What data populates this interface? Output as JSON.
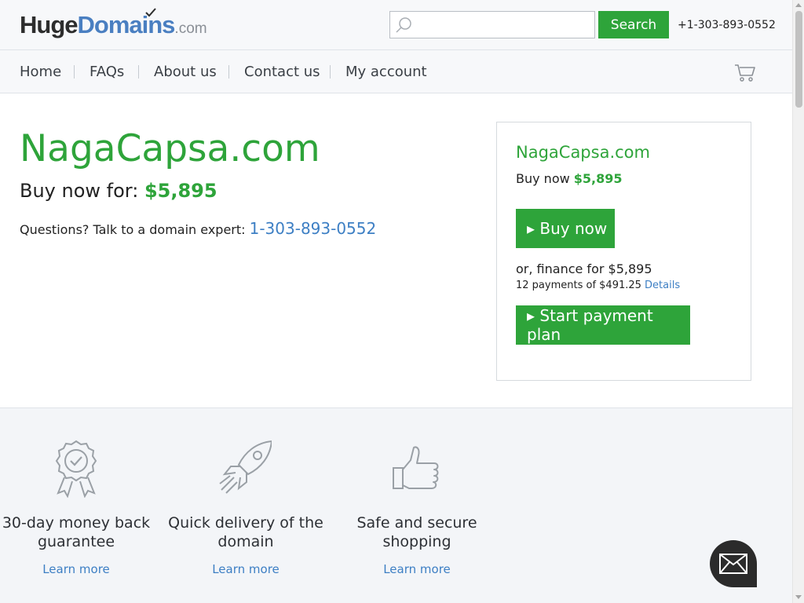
{
  "header": {
    "logo": {
      "huge": "Huge",
      "domains": "Domains",
      "com": ".com"
    },
    "search": {
      "placeholder": "",
      "button_label": "Search"
    },
    "phone": "+1-303-893-0552"
  },
  "nav": {
    "items": [
      {
        "label": "Home"
      },
      {
        "label": "FAQs"
      },
      {
        "label": "About us"
      },
      {
        "label": "Contact us"
      },
      {
        "label": "My account"
      }
    ],
    "cart_icon": "shopping-cart-icon"
  },
  "main": {
    "domain": "NagaCapsa.com",
    "buy_prefix": "Buy now for: ",
    "price": "$5,895",
    "questions_text": "Questions? Talk to a domain expert: ",
    "expert_phone": "1-303-893-0552"
  },
  "panel": {
    "domain": "NagaCapsa.com",
    "buy_now_prefix": "Buy now ",
    "price": "$5,895",
    "buy_button": "▸ Buy now",
    "finance_text": "or, finance for $5,895",
    "payments_text": "12 payments of $491.25 ",
    "details_link": "Details",
    "plan_button": "▸ Start payment plan"
  },
  "features": [
    {
      "icon": "ribbon-check-icon",
      "title": "30-day money back guarantee",
      "link": "Learn more"
    },
    {
      "icon": "rocket-icon",
      "title": "Quick delivery of the domain",
      "link": "Learn more"
    },
    {
      "icon": "thumbs-up-icon",
      "title": "Safe and secure shopping",
      "link": "Learn more"
    }
  ],
  "colors": {
    "brand_green": "#2ea43a",
    "link_blue": "#3d7fc4",
    "logo_blue": "#4a7fc1"
  },
  "chat": {
    "icon": "envelope-icon"
  }
}
